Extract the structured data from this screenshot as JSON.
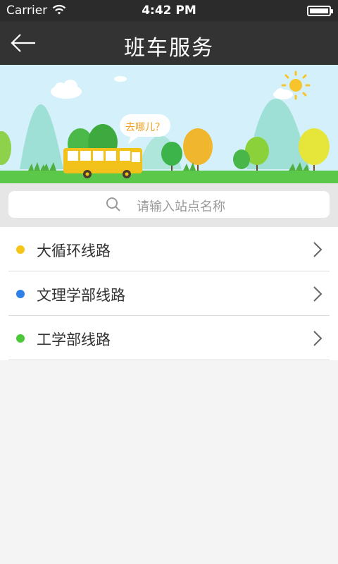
{
  "status_bar": {
    "carrier": "Carrier",
    "time": "4:42 PM",
    "icons": [
      "wifi-icon",
      "battery-icon"
    ]
  },
  "nav": {
    "title": "班车服务",
    "back_icon": "arrow-left-icon"
  },
  "banner": {
    "speech_text": "去哪儿？"
  },
  "search": {
    "placeholder": "请输入站点名称",
    "icon": "search-icon"
  },
  "routes": [
    {
      "label": "大循环线路",
      "color": "#f5c518"
    },
    {
      "label": "文理学部线路",
      "color": "#2f80e8"
    },
    {
      "label": "工学部线路",
      "color": "#4cc83a"
    }
  ],
  "colors": {
    "nav_bg": "#333333",
    "status_bg": "#2b2b2b",
    "page_bg": "#f4f4f4"
  }
}
